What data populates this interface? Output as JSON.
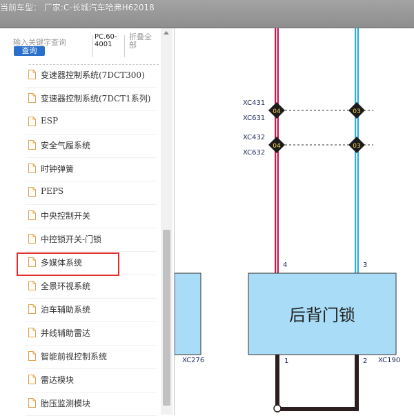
{
  "header": {
    "title": "当前车型： 厂家:C-长城汽车哈弗H62018"
  },
  "search": {
    "placeholder": "输入关键字查询",
    "button_label": "查询"
  },
  "toolbar": {
    "pc_label": "PC.60-4001",
    "collapse_label": "折叠全部"
  },
  "tree": {
    "items": [
      {
        "label": "变速器控制系统(7DCT300)",
        "selected": false
      },
      {
        "label": "变速器控制系统(7DCT1系列)",
        "selected": false
      },
      {
        "label": "ESP",
        "selected": false
      },
      {
        "label": "安全气履系统",
        "selected": false
      },
      {
        "label": "时钟弹簧",
        "selected": false
      },
      {
        "label": "PEPS",
        "selected": false
      },
      {
        "label": "中央控制开关",
        "selected": false
      },
      {
        "label": "中控锁开关-门锁",
        "selected": true
      },
      {
        "label": "多媒体系统",
        "selected": false
      },
      {
        "label": "全景环视系统",
        "selected": false
      },
      {
        "label": "泊车辅助系统",
        "selected": false
      },
      {
        "label": "并线辅助雷达",
        "selected": false
      },
      {
        "label": "智能前视控制系统",
        "selected": false
      },
      {
        "label": "雷达模块",
        "selected": false
      },
      {
        "label": "胎压监测模块",
        "selected": false
      }
    ]
  },
  "diagram": {
    "connectors": {
      "c1": "XC431",
      "c2": "XC631",
      "c3": "XC432",
      "c4": "XC632",
      "left_module": "XC276",
      "main_module": "XC190"
    },
    "badges": {
      "red_top": "04",
      "blue_top": "03",
      "red_bottom": "04",
      "blue_bottom": "03"
    },
    "pins": {
      "red_wire": "4",
      "blue_wire": "3",
      "bottom_left": "1",
      "bottom_right": "2"
    },
    "module_label": "后背门锁",
    "colors": {
      "red_wire": "#c41d52",
      "blue_wire": "#37a9db",
      "module_fill": "#a9ddf7",
      "ground_wire": "#2a1e1e"
    }
  }
}
